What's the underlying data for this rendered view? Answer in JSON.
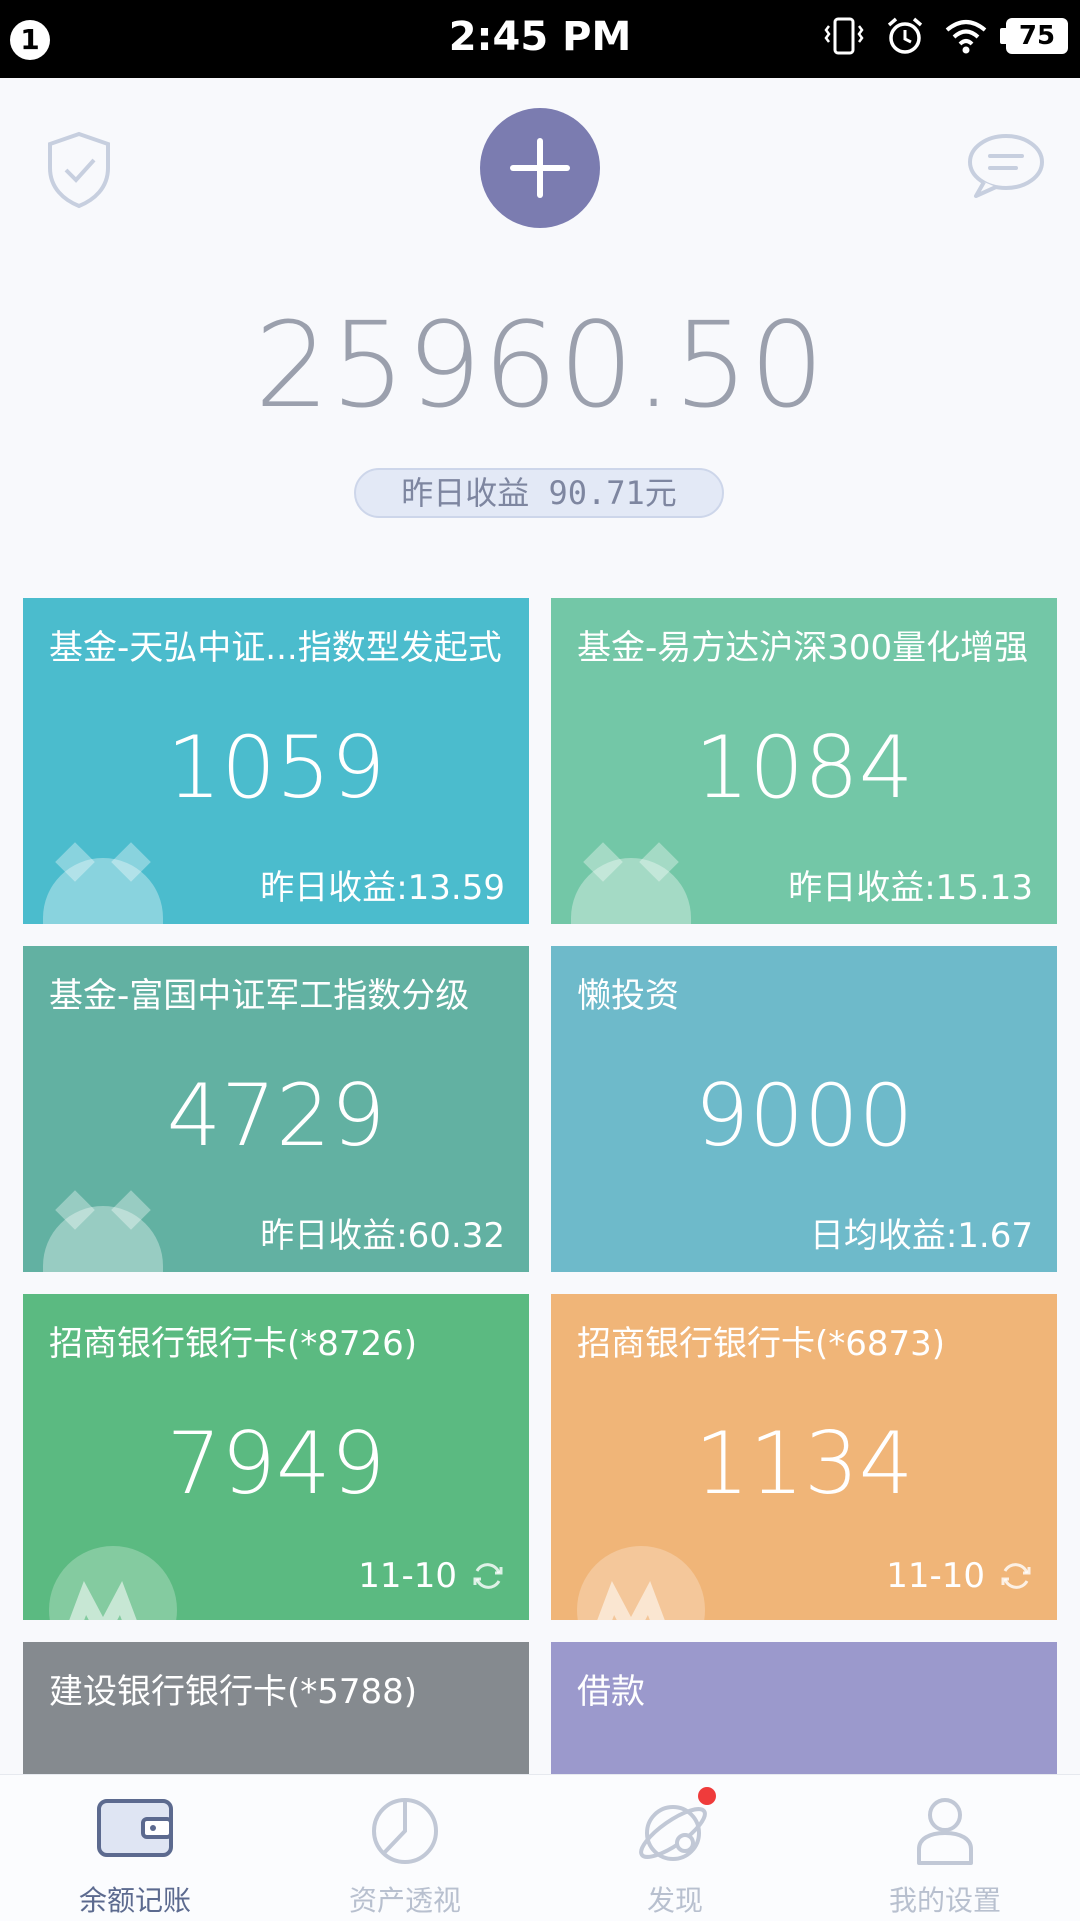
{
  "status_bar": {
    "notification_count": "1",
    "time": "2:45 PM",
    "battery": "75"
  },
  "header": {
    "total": "25960.50",
    "yield_label": "昨日收益 90.71元"
  },
  "cards": [
    {
      "title": "基金-天弘中证...指数型发起式",
      "value": "1059",
      "sub": "昨日收益:13.59",
      "color": "#4bbccd",
      "icon": "piggy-bank-icon"
    },
    {
      "title": "基金-易方达沪深300量化增强",
      "value": "1084",
      "sub": "昨日收益:15.13",
      "color": "#73c7a7",
      "icon": "piggy-bank-icon"
    },
    {
      "title": "基金-富国中证军工指数分级",
      "value": "4729",
      "sub": "昨日收益:60.32",
      "color": "#62b1a2",
      "icon": "piggy-bank-icon"
    },
    {
      "title": "懒投资",
      "value": "9000",
      "sub": "日均收益:1.67",
      "color": "#6ebaca",
      "icon": ""
    },
    {
      "title": "招商银行银行卡(*8726)",
      "value": "7949",
      "date": "11-10",
      "color": "#5bba81",
      "icon": "cmb-logo-icon"
    },
    {
      "title": "招商银行银行卡(*6873)",
      "value": "1134",
      "date": "11-10",
      "color": "#f0b578",
      "icon": "cmb-logo-icon"
    },
    {
      "title": "建设银行银行卡(*5788)",
      "color": "#858a8f"
    },
    {
      "title": "借款",
      "color": "#9b99cc"
    }
  ],
  "bottom_nav": [
    {
      "label": "余额记账",
      "icon": "wallet-icon",
      "active": true
    },
    {
      "label": "资产透视",
      "icon": "pie-chart-icon",
      "active": false
    },
    {
      "label": "发现",
      "icon": "planet-icon",
      "active": false,
      "badge": true
    },
    {
      "label": "我的设置",
      "icon": "user-icon",
      "active": false
    }
  ],
  "colors": {
    "accent": "#7b7cb0",
    "badge": "#ef3b3b"
  }
}
